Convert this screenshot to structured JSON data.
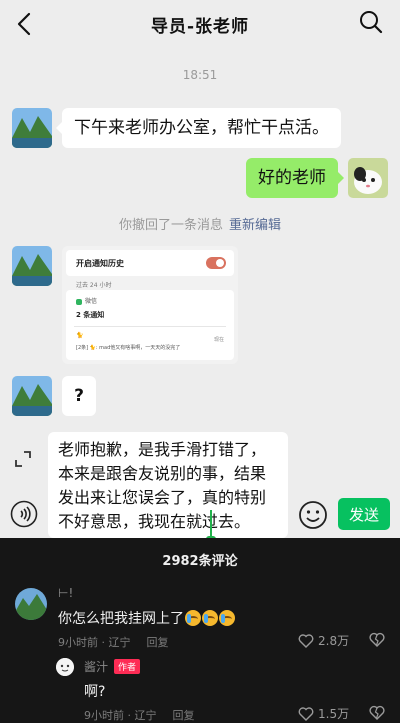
{
  "header": {
    "title": "导员-张老师"
  },
  "chat": {
    "time": "18:51",
    "msg1": "下午来老师办公室，帮忙干点活。",
    "msg2": "好的老师",
    "recall_text": "你撤回了一条消息",
    "recall_edit": "重新编辑",
    "screenshot": {
      "history_label": "开启通知历史",
      "past_label": "过去 24 小时",
      "app_name": "微信",
      "notif_count": "2 条通知",
      "sender": "🐈",
      "now": "现在",
      "message": "[2条] 🐈: mad他又有啥事啊，一天天的没完了"
    },
    "msg3": "?",
    "input_text": "老师抱歉，是我手滑打错了，本来是跟舍友说别的事，结果发出来让您误会了，真的特别不好意思，我现在就过去。",
    "send_label": "发送"
  },
  "comments": {
    "count": "2982条评论",
    "c1": {
      "user": "⊢!",
      "text": "你怎么把我挂网上了",
      "time": "9小时前 · 辽宁",
      "reply": "回复",
      "likes": "2.8万"
    },
    "c2": {
      "user": "酱汁",
      "badge": "作者",
      "text": "啊?",
      "time": "9小时前 · 辽宁",
      "reply": "回复",
      "likes": "1.5万"
    }
  },
  "colors": {
    "send_green": "#07c160",
    "self_bubble": "#95ec69",
    "link_blue": "#576b95",
    "author_red": "#fe2c55"
  },
  "icons": [
    "back-arrow-icon",
    "search-icon",
    "landscape-avatar",
    "cat-avatar",
    "expand-icon",
    "voice-icon",
    "emoji-icon",
    "heart-icon",
    "broken-heart-icon"
  ]
}
